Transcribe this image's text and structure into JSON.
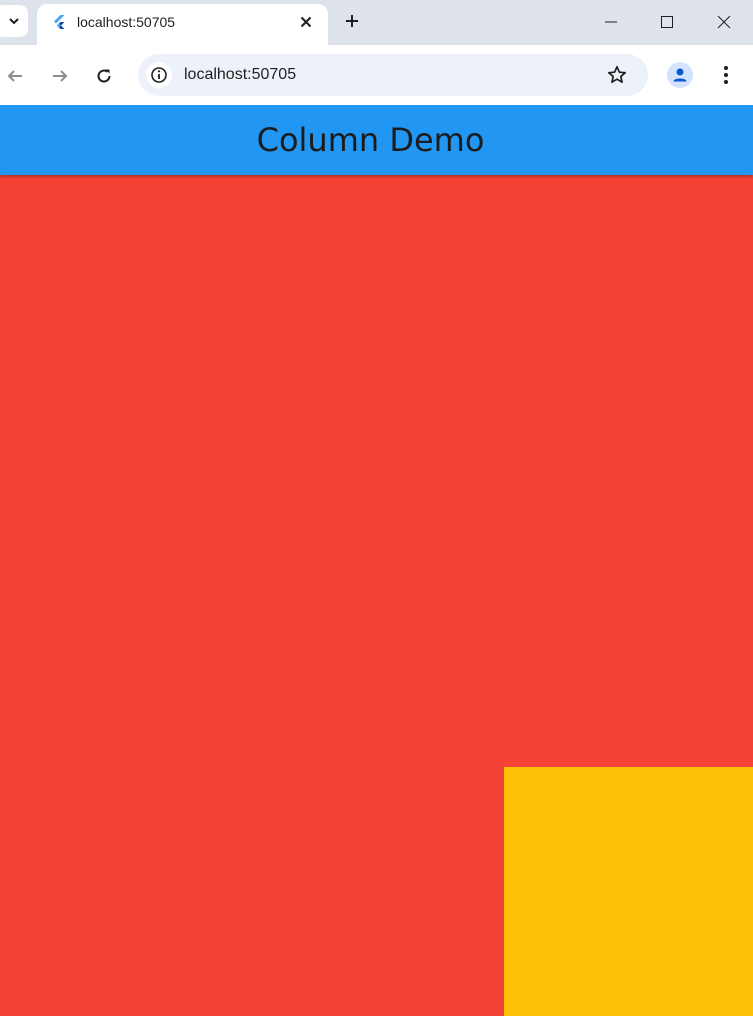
{
  "browser": {
    "tab_title": "localhost:50705",
    "url": "localhost:50705",
    "icons": {
      "tab_search": "chevron-down-icon",
      "favicon": "flutter-logo-icon",
      "tab_close": "close-icon",
      "new_tab": "plus-icon",
      "minimize": "minimize-icon",
      "maximize": "maximize-icon",
      "window_close": "window-close-icon",
      "back": "arrow-left-icon",
      "forward": "arrow-right-icon",
      "reload": "reload-icon",
      "site_info": "info-icon",
      "bookmark": "star-icon",
      "profile": "person-icon",
      "menu": "kebab-menu-icon"
    }
  },
  "app": {
    "title": "Column Demo",
    "colors": {
      "appbar": "#2196F3",
      "red_container": "#F44336",
      "amber_container": "#FFC107"
    }
  }
}
